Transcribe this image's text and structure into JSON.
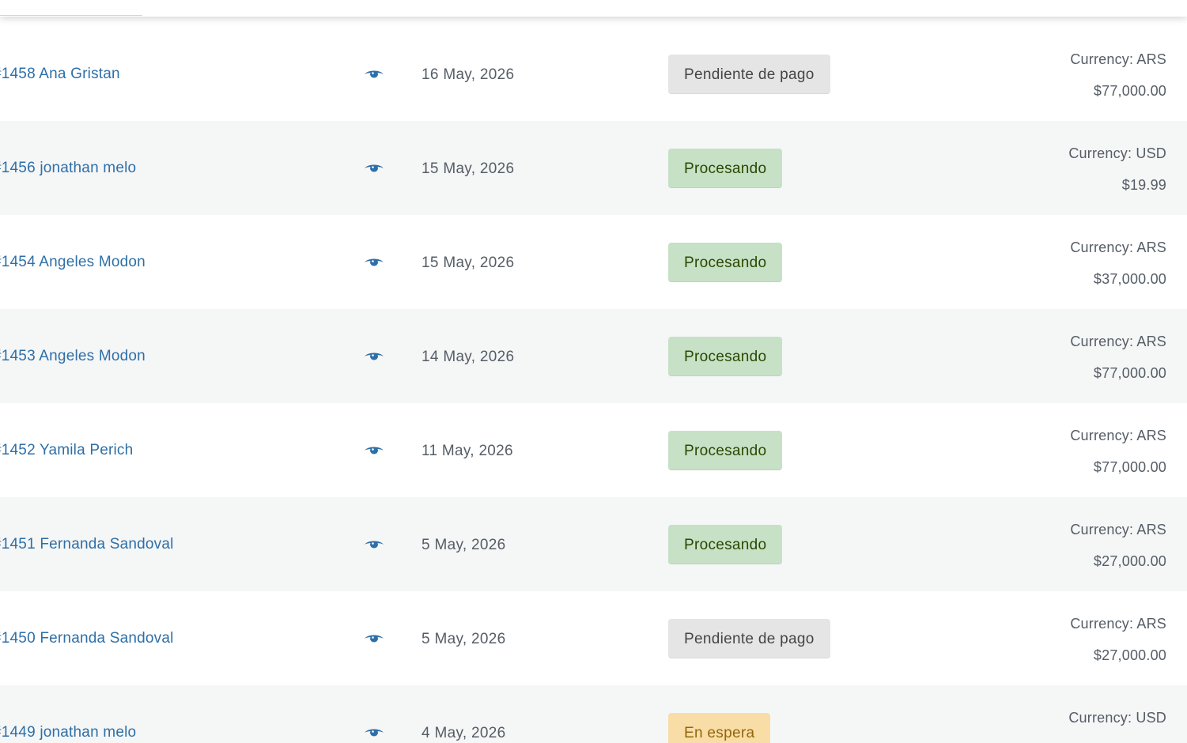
{
  "orders": [
    {
      "number": "#1458",
      "customer": "Ana Gristan",
      "date": "16 May, 2026",
      "status": "Pendiente de pago",
      "status_type": "pending",
      "currency": "Currency: ARS",
      "total": "$77,000.00"
    },
    {
      "number": "#1456",
      "customer": "jonathan melo",
      "date": "15 May, 2026",
      "status": "Procesando",
      "status_type": "processing",
      "currency": "Currency: USD",
      "total": "$19.99"
    },
    {
      "number": "#1454",
      "customer": "Angeles Modon",
      "date": "15 May, 2026",
      "status": "Procesando",
      "status_type": "processing",
      "currency": "Currency: ARS",
      "total": "$37,000.00"
    },
    {
      "number": "#1453",
      "customer": "Angeles Modon",
      "date": "14 May, 2026",
      "status": "Procesando",
      "status_type": "processing",
      "currency": "Currency: ARS",
      "total": "$77,000.00"
    },
    {
      "number": "#1452",
      "customer": "Yamila Perich",
      "date": "11 May, 2026",
      "status": "Procesando",
      "status_type": "processing",
      "currency": "Currency: ARS",
      "total": "$77,000.00"
    },
    {
      "number": "#1451",
      "customer": "Fernanda Sandoval",
      "date": "5 May, 2026",
      "status": "Procesando",
      "status_type": "processing",
      "currency": "Currency: ARS",
      "total": "$27,000.00"
    },
    {
      "number": "#1450",
      "customer": "Fernanda Sandoval",
      "date": "5 May, 2026",
      "status": "Pendiente de pago",
      "status_type": "pending",
      "currency": "Currency: ARS",
      "total": "$27,000.00"
    },
    {
      "number": "#1449",
      "customer": "jonathan melo",
      "date": "4 May, 2026",
      "status": "En espera",
      "status_type": "onhold",
      "currency": "Currency: USD",
      "total": ""
    }
  ],
  "icons": {
    "view": "eye-icon"
  },
  "colors": {
    "link": "#2e6fa8",
    "pending_bg": "#e5e5e5",
    "processing_bg": "#c6e1c6",
    "onhold_bg": "#f8dda7",
    "row_alt_bg": "#f5f6f6"
  }
}
